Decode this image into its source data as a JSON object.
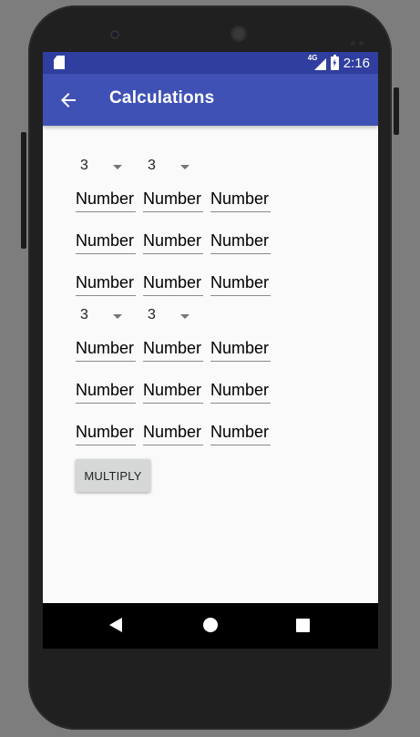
{
  "status_bar": {
    "network_label": "4G",
    "time": "2:16"
  },
  "app_bar": {
    "title": "Calculations",
    "back_icon": "arrow-back-icon"
  },
  "matrix_a": {
    "rows_spinner": "3",
    "cols_spinner": "3",
    "placeholder": "Number"
  },
  "matrix_b": {
    "rows_spinner": "3",
    "cols_spinner": "3",
    "placeholder": "Number"
  },
  "actions": {
    "multiply_label": "MULTIPLY"
  },
  "colors": {
    "status_bar": "#303f9f",
    "app_bar": "#3f51b5",
    "button": "#d6d7d7"
  }
}
